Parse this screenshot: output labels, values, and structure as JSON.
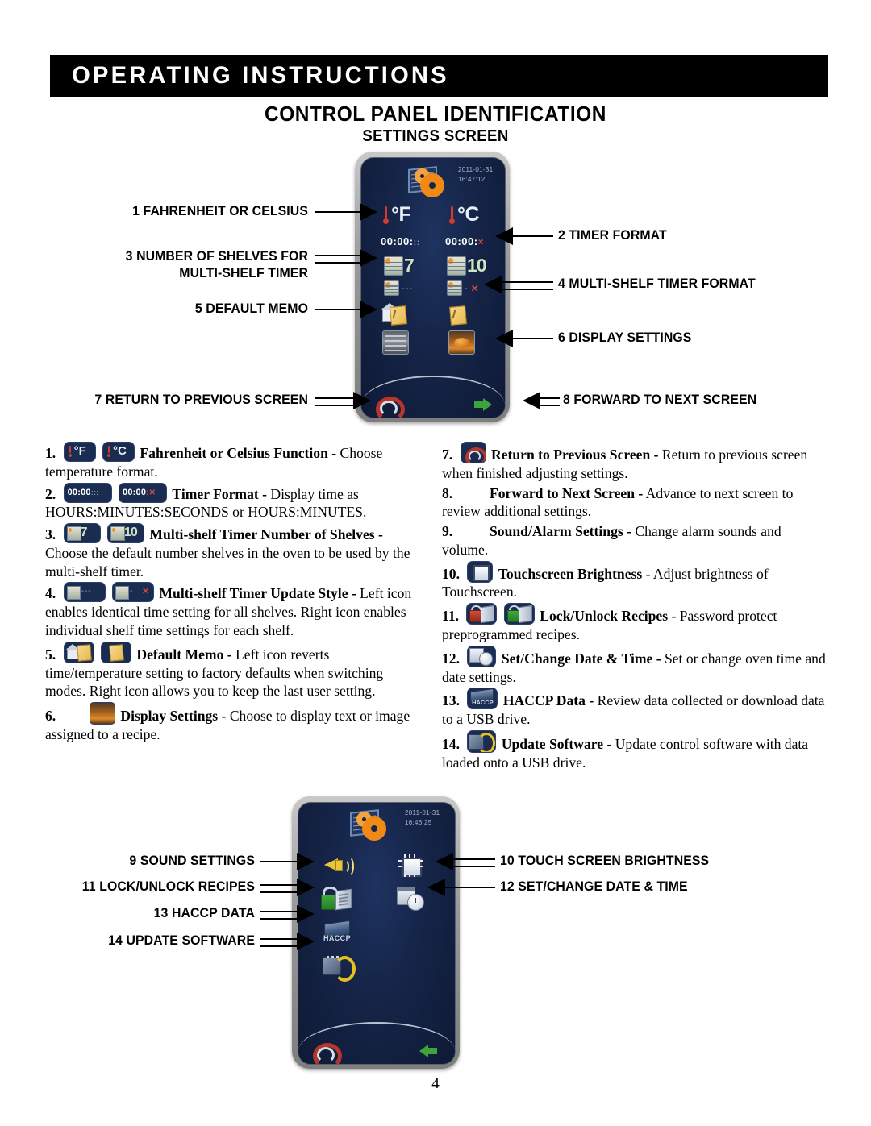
{
  "header": {
    "banner": "OPERATING INSTRUCTIONS",
    "title": "CONTROL PANEL IDENTIFICATION",
    "subtitle": "SETTINGS SCREEN"
  },
  "settings_screen": {
    "date": "2011-01-31",
    "time": "16:47:12",
    "options": {
      "fahrenheit": "°F",
      "celsius": "°C",
      "timer_hms": "00:00:",
      "timer_hms_suffix": "::",
      "timer_hm": "00:00:",
      "timer_hm_suffix": "×",
      "shelves_left": "7",
      "shelves_right": "10"
    }
  },
  "second_screen": {
    "date": "2011-01-31",
    "time": "16:46:25",
    "haccp_label": "HACCP"
  },
  "callouts_top": {
    "left": [
      {
        "num": "1",
        "label": "1 FAHRENHEIT OR CELSIUS"
      },
      {
        "num": "3",
        "label": "3 NUMBER OF SHELVES FOR"
      },
      {
        "num": "3b",
        "label": "MULTI-SHELF TIMER"
      },
      {
        "num": "5",
        "label": "5 DEFAULT MEMO"
      },
      {
        "num": "7",
        "label": "7 RETURN TO PREVIOUS SCREEN"
      }
    ],
    "right": [
      {
        "num": "2",
        "label": "2 TIMER FORMAT"
      },
      {
        "num": "4",
        "label": "4 MULTI-SHELF TIMER FORMAT"
      },
      {
        "num": "6",
        "label": "6 DISPLAY SETTINGS"
      },
      {
        "num": "8",
        "label": "8 FORWARD TO NEXT SCREEN"
      }
    ]
  },
  "callouts_bottom": {
    "left": [
      {
        "num": "9",
        "label": "9 SOUND SETTINGS"
      },
      {
        "num": "11",
        "label": "11 LOCK/UNLOCK RECIPES"
      },
      {
        "num": "13",
        "label": "13 HACCP DATA"
      },
      {
        "num": "14",
        "label": "14 UPDATE SOFTWARE"
      }
    ],
    "right": [
      {
        "num": "10",
        "label": "10 TOUCH SCREEN BRIGHTNESS"
      },
      {
        "num": "12",
        "label": "12 SET/CHANGE DATE & TIME"
      }
    ]
  },
  "list_left": [
    {
      "num": "1.",
      "lead": "Fahrenheit or Celsius Function -",
      "body": " Choose temperature format."
    },
    {
      "num": "2.",
      "lead": "Timer Format -",
      "body": " Display time as HOURS:MINUTES:SECONDS or HOURS:MINUTES."
    },
    {
      "num": "3.",
      "lead": "Multi-shelf Timer Number of Shelves -",
      "body": " Choose the default number shelves in the oven to be used by the multi-shelf timer."
    },
    {
      "num": "4.",
      "lead": "Multi-shelf Timer Update Style -",
      "body": " Left icon enables identical time setting for all shelves.  Right icon enables individual shelf time settings for each shelf."
    },
    {
      "num": "5.",
      "lead": "Default Memo -",
      "body": " Left icon reverts time/temperature setting to factory defaults when switching modes. Right icon allows you to keep the last user setting."
    },
    {
      "num": "6.",
      "lead": "Display Settings -",
      "body": " Choose to display text or image assigned to a recipe."
    }
  ],
  "list_right": [
    {
      "num": "7.",
      "lead": "Return to Previous Screen -",
      "body": " Return to previous screen when finished adjusting settings."
    },
    {
      "num": "8.",
      "lead": "Forward to Next Screen -",
      "body": " Advance to next screen to review additional settings."
    },
    {
      "num": "9.",
      "lead": "Sound/Alarm Settings -",
      "body": " Change alarm sounds and volume."
    },
    {
      "num": "10.",
      "lead": "Touchscreen Brightness -",
      "body": " Adjust brightness of Touchscreen."
    },
    {
      "num": "11.",
      "lead": "Lock/Unlock Recipes -",
      "body": " Password protect preprogrammed recipes."
    },
    {
      "num": "12.",
      "lead": "Set/Change Date & Time -",
      "body": " Set or change oven time and date settings."
    },
    {
      "num": "13.",
      "lead": "HACCP Data -",
      "body": " Review data collected or download data to a USB drive."
    },
    {
      "num": "14.",
      "lead": "Update Software -",
      "body": " Update control software with data loaded onto a USB drive."
    }
  ],
  "footer": {
    "page_number": "4"
  }
}
